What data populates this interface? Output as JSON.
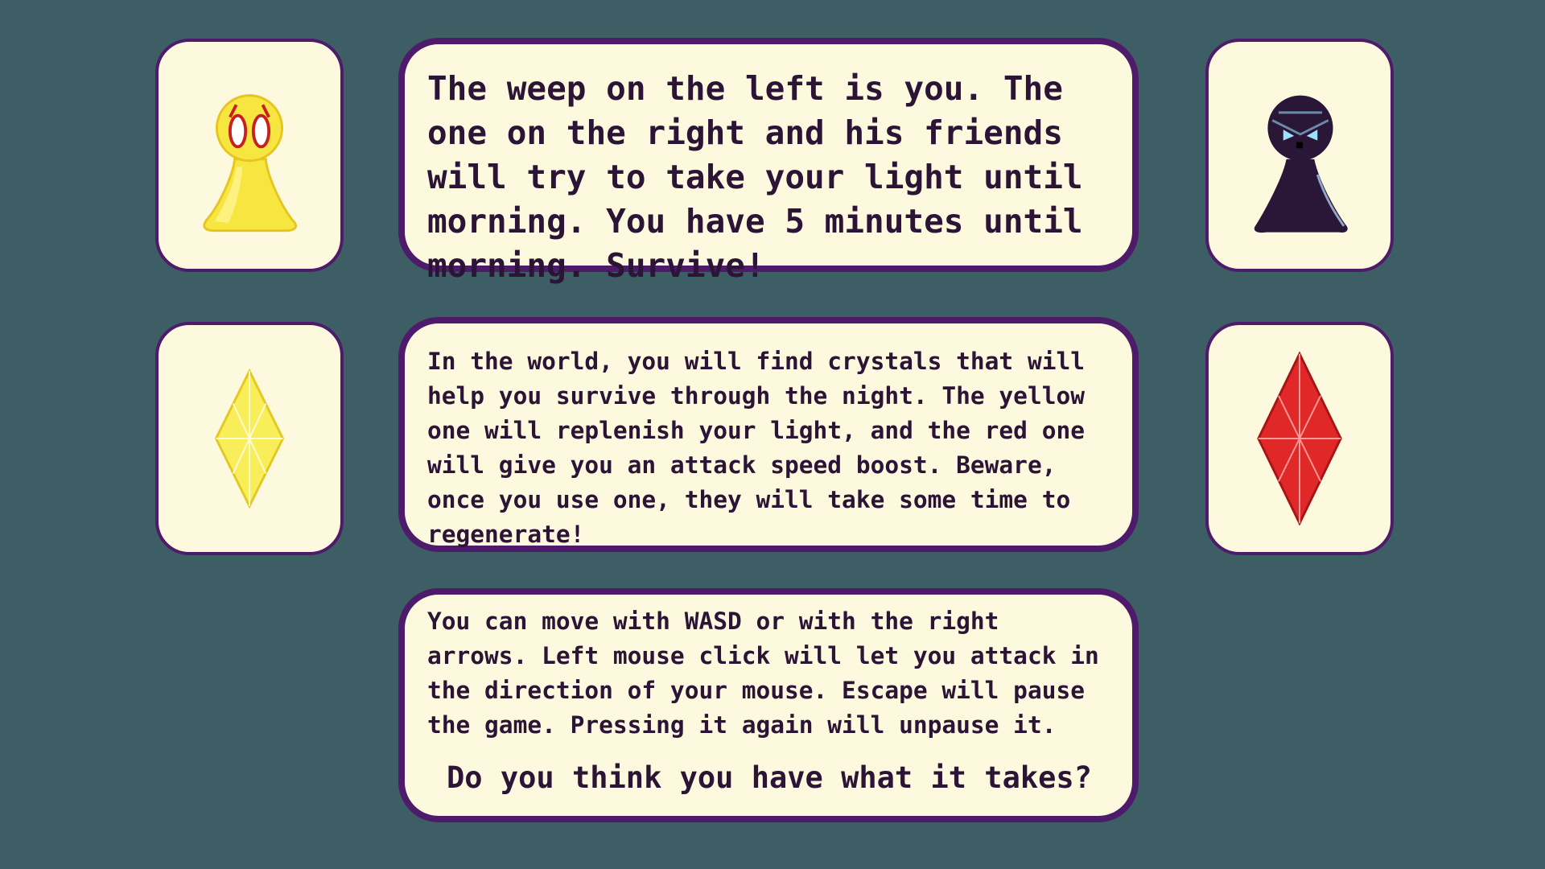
{
  "colors": {
    "background": "#3e5e66",
    "panel": "#fdf9de",
    "border": "#4e1a6a",
    "text": "#2c1436",
    "player_yellow": "#f8e640",
    "enemy_dark": "#2a1636",
    "crystal_yellow": "#f8ee5a",
    "crystal_red": "#e02828"
  },
  "cards": {
    "player": {
      "icon": "yellow-weep-player-icon"
    },
    "enemy": {
      "icon": "dark-weep-enemy-icon"
    },
    "yellow_crystal": {
      "icon": "yellow-crystal-icon"
    },
    "red_crystal": {
      "icon": "red-crystal-icon"
    }
  },
  "panels": {
    "intro": "The weep on the left is you. The one on the right and his friends will try to take your light until morning. You have 5 minutes until morning. Survive!",
    "crystals": "In the world, you will find crystals that will help you survive through the night. The yellow one will replenish your light, and the red one will give you an attack speed boost. Beware, once you use one, they will take some time to regenerate!",
    "controls": "You can move with WASD or with the right arrows. Left mouse click will let you attack in the direction of your mouse. Escape will pause the game. Pressing it again will unpause it.",
    "question": "Do you think you have what it takes?"
  }
}
